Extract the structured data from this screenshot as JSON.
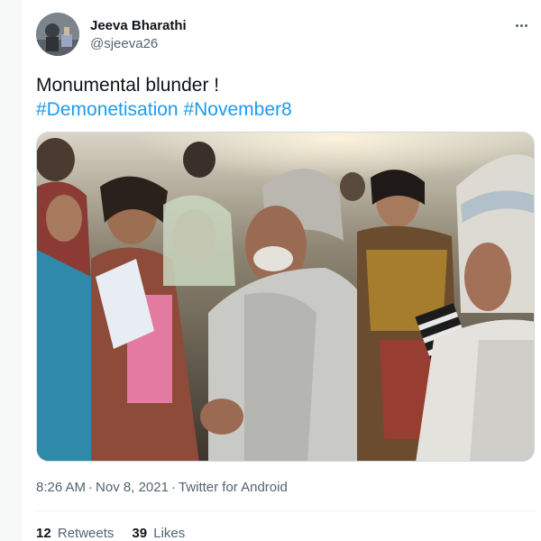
{
  "tweet": {
    "author_name": "Jeeva Bharathi",
    "author_handle": "@sjeeva26",
    "text": "Monumental blunder !",
    "hashtags": [
      "#Demonetisation",
      "#November8"
    ],
    "time": "8:26 AM",
    "date": "Nov 8, 2021",
    "source": "Twitter for Android",
    "separator": "·"
  },
  "stats": {
    "retweets_count": "12",
    "retweets_label": "Retweets",
    "likes_count": "39",
    "likes_label": "Likes"
  },
  "icons": {
    "more": "more-horizontal-icon"
  },
  "colors": {
    "link": "#1d9bf0",
    "secondary_text": "#536471",
    "primary_text": "#0f1419"
  }
}
